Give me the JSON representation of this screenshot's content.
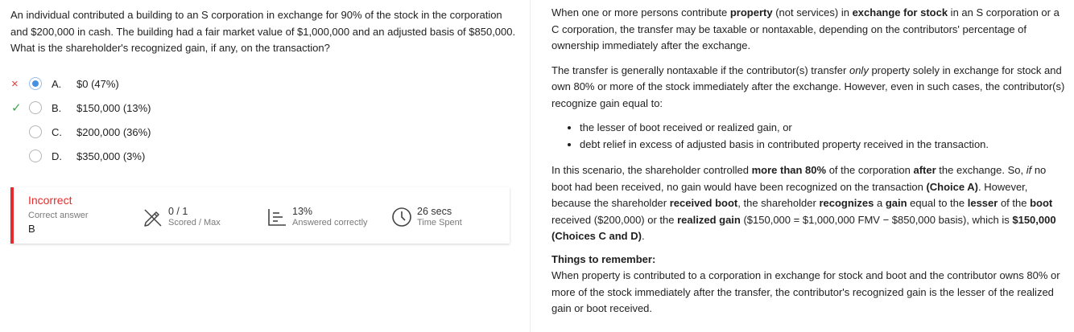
{
  "question": {
    "text": "An individual contributed a building to an S corporation in exchange for 90% of the stock in the corporation and $200,000 in cash.  The building had a fair market value of $1,000,000 and an adjusted basis of $850,000.  What is the shareholder's recognized gain, if any, on the transaction?"
  },
  "choices": [
    {
      "letter": "A.",
      "text": "$0 (47%)",
      "mark": "×",
      "selected": true
    },
    {
      "letter": "B.",
      "text": "$150,000 (13%)",
      "mark": "✓",
      "selected": false
    },
    {
      "letter": "C.",
      "text": "$200,000 (36%)",
      "mark": "",
      "selected": false
    },
    {
      "letter": "D.",
      "text": "$350,000 (3%)",
      "mark": "",
      "selected": false
    }
  ],
  "result": {
    "status": "Incorrect",
    "correct_answer_label": "Correct answer",
    "correct_answer_value": "B",
    "scored_value": "0 / 1",
    "scored_label": "Scored / Max",
    "answered_value": "13%",
    "answered_label": "Answered correctly",
    "time_value": "26 secs",
    "time_label": "Time Spent",
    "colors": {
      "incorrect": "#e52b2b",
      "correct": "#3aa64b",
      "selected": "#4a90e2"
    }
  },
  "explanation": {
    "p1": {
      "a": "When one or more persons contribute ",
      "b1": "property",
      "c": " (not services) in ",
      "b2": "exchange for stock",
      "d": " in an S corporation or a C corporation, the transfer may be taxable or nontaxable, depending on the contributors' percentage of ownership immediately after the exchange."
    },
    "p2": {
      "a": "The transfer is generally nontaxable if the contributor(s) transfer ",
      "i1": "only",
      "b": " property solely in exchange for stock and own 80% or more of the stock immediately after the exchange.  However, even in such cases, the contributor(s) recognize gain equal to:"
    },
    "bullets": [
      "the lesser of boot received or realized gain, or",
      "debt relief in excess of adjusted basis in contributed property received in the transaction."
    ],
    "p3": {
      "t1": "In this scenario, the shareholder controlled ",
      "b1": "more than 80%",
      "t2": " of the corporation ",
      "b2": "after",
      "t3": " the exchange.  So, ",
      "i1": "if",
      "t4": " no boot had been received, no gain would have been recognized on the transaction ",
      "b3": "(Choice A)",
      "t5": ".  However, because the shareholder ",
      "b4": "received boot",
      "t6": ", the shareholder ",
      "b5": "recognizes",
      "t7": " a ",
      "b6": "gain",
      "t8": " equal to the ",
      "b7": "lesser",
      "t9": " of the ",
      "b8": "boot",
      "t10": " received ($200,000) or the ",
      "b9": "realized gain",
      "t11": " ($150,000 = $1,000,000 FMV − $850,000 basis), which is ",
      "b10": "$150,000 (Choices C and D)",
      "t12": "."
    },
    "remember_heading": "Things to remember:",
    "remember_text": "When property is contributed to a corporation in exchange for stock and boot and the contributor owns 80% or more of the stock immediately after the transfer, the contributor's recognized gain is the lesser of the realized gain or boot received."
  }
}
